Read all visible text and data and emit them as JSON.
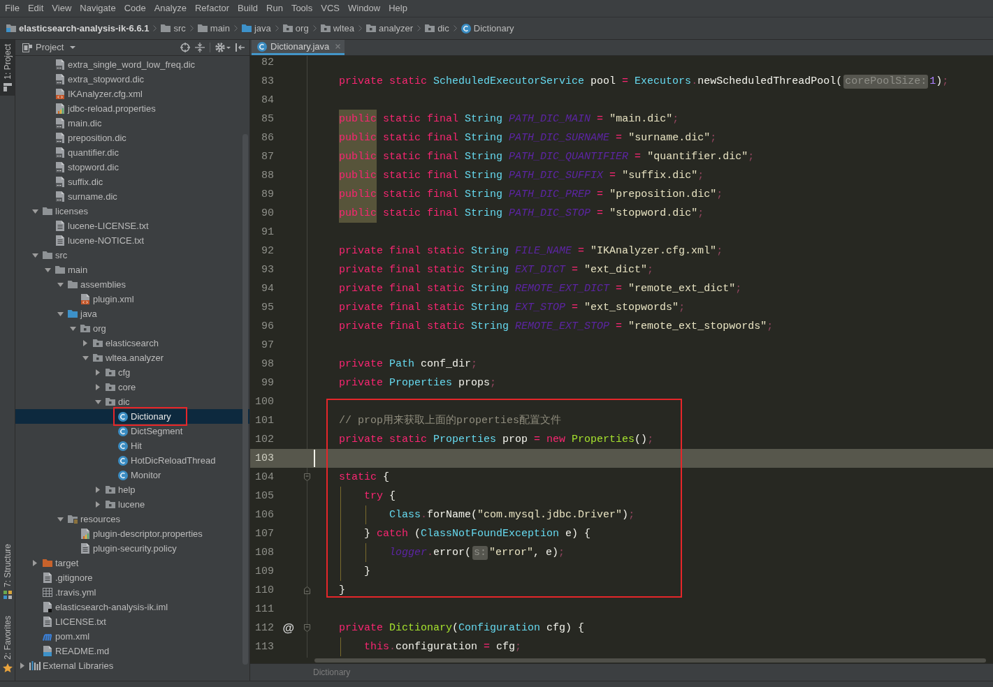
{
  "menu": [
    "File",
    "Edit",
    "View",
    "Navigate",
    "Code",
    "Analyze",
    "Refactor",
    "Build",
    "Run",
    "Tools",
    "VCS",
    "Window",
    "Help"
  ],
  "breadcrumb": [
    {
      "label": "elasticsearch-analysis-ik-6.6.1",
      "kind": "module"
    },
    {
      "label": "src",
      "kind": "folder"
    },
    {
      "label": "main",
      "kind": "folder"
    },
    {
      "label": "java",
      "kind": "source"
    },
    {
      "label": "org",
      "kind": "package"
    },
    {
      "label": "wltea",
      "kind": "package"
    },
    {
      "label": "analyzer",
      "kind": "package"
    },
    {
      "label": "dic",
      "kind": "package"
    },
    {
      "label": "Dictionary",
      "kind": "class"
    }
  ],
  "tool_strip": {
    "top": [
      {
        "label": "1: Project",
        "kind": "project",
        "selected": true
      }
    ],
    "bottom": [
      {
        "label": "7: Structure",
        "kind": "structure",
        "selected": false
      },
      {
        "label": "2: Favorites",
        "kind": "favorites",
        "selected": false
      }
    ]
  },
  "project": {
    "title": "Project",
    "tree": [
      {
        "children": [
          {
            "children": [
              {
                "label": "extra_single_word_low_freq.dic",
                "kind": "dic",
                "selected": false
              },
              {
                "label": "extra_stopword.dic",
                "kind": "dic",
                "selected": false
              },
              {
                "label": "IKAnalyzer.cfg.xml",
                "kind": "xml",
                "selected": false
              },
              {
                "label": "jdbc-reload.properties",
                "kind": "properties",
                "selected": false
              },
              {
                "label": "main.dic",
                "kind": "dic",
                "selected": false
              },
              {
                "label": "preposition.dic",
                "kind": "dic",
                "selected": false
              },
              {
                "label": "quantifier.dic",
                "kind": "dic",
                "selected": false
              },
              {
                "label": "stopword.dic",
                "kind": "dic",
                "selected": false
              },
              {
                "label": "suffix.dic",
                "kind": "dic",
                "selected": false
              },
              {
                "label": "surname.dic",
                "kind": "dic",
                "selected": false
              }
            ]
          },
          {
            "label": "licenses",
            "kind": "folder",
            "expanded": true,
            "selected": false,
            "children": [
              {
                "label": "lucene-LICENSE.txt",
                "kind": "text",
                "selected": false
              },
              {
                "label": "lucene-NOTICE.txt",
                "kind": "text",
                "selected": false
              }
            ]
          },
          {
            "label": "src",
            "kind": "folder",
            "expanded": true,
            "selected": false,
            "children": [
              {
                "label": "main",
                "kind": "folder",
                "expanded": true,
                "selected": false,
                "children": [
                  {
                    "label": "assemblies",
                    "kind": "folder",
                    "expanded": true,
                    "selected": false,
                    "children": [
                      {
                        "label": "plugin.xml",
                        "kind": "xml",
                        "selected": false
                      }
                    ]
                  },
                  {
                    "label": "java",
                    "kind": "source",
                    "expanded": true,
                    "selected": false,
                    "children": [
                      {
                        "label": "org",
                        "kind": "package",
                        "expanded": true,
                        "selected": false,
                        "children": [
                          {
                            "label": "elasticsearch",
                            "kind": "package",
                            "expanded": false,
                            "selected": false
                          },
                          {
                            "label": "wltea.analyzer",
                            "kind": "package",
                            "expanded": true,
                            "selected": false,
                            "children": [
                              {
                                "label": "cfg",
                                "kind": "package",
                                "expanded": false,
                                "selected": false
                              },
                              {
                                "label": "core",
                                "kind": "package",
                                "expanded": false,
                                "selected": false
                              },
                              {
                                "label": "dic",
                                "kind": "package",
                                "expanded": true,
                                "selected": false,
                                "children": [
                                  {
                                    "label": "Dictionary",
                                    "kind": "class",
                                    "selected": true
                                  },
                                  {
                                    "label": "DictSegment",
                                    "kind": "class",
                                    "selected": false
                                  },
                                  {
                                    "label": "Hit",
                                    "kind": "class",
                                    "selected": false
                                  },
                                  {
                                    "label": "HotDicReloadThread",
                                    "kind": "class",
                                    "selected": false
                                  },
                                  {
                                    "label": "Monitor",
                                    "kind": "class",
                                    "selected": false
                                  }
                                ]
                              },
                              {
                                "label": "help",
                                "kind": "package",
                                "expanded": false,
                                "selected": false
                              },
                              {
                                "label": "lucene",
                                "kind": "package",
                                "expanded": false,
                                "selected": false
                              }
                            ]
                          }
                        ]
                      }
                    ]
                  },
                  {
                    "label": "resources",
                    "kind": "resources",
                    "expanded": true,
                    "selected": false,
                    "children": [
                      {
                        "label": "plugin-descriptor.properties",
                        "kind": "properties",
                        "selected": false
                      },
                      {
                        "label": "plugin-security.policy",
                        "kind": "text",
                        "selected": false
                      }
                    ]
                  }
                ]
              }
            ]
          },
          {
            "label": "target",
            "kind": "excluded",
            "expanded": false,
            "selected": false
          },
          {
            "label": ".gitignore",
            "kind": "text",
            "selected": false
          },
          {
            "label": ".travis.yml",
            "kind": "table",
            "selected": false
          },
          {
            "label": "elasticsearch-analysis-ik.iml",
            "kind": "module_file",
            "selected": false
          },
          {
            "label": "LICENSE.txt",
            "kind": "text",
            "selected": false
          },
          {
            "label": "pom.xml",
            "kind": "maven",
            "selected": false
          },
          {
            "label": "README.md",
            "kind": "markdown",
            "selected": false
          }
        ]
      },
      {
        "label": "External Libraries",
        "kind": "libraries",
        "expanded": false,
        "selected": false
      }
    ]
  },
  "editor": {
    "tab": {
      "label": "Dictionary.java",
      "selected": true
    },
    "lines": [
      {
        "number": "82",
        "current": false
      },
      {
        "number": "83",
        "current": false,
        "tokens": [
          {
            "kind": "kw",
            "text": "    private static "
          },
          {
            "kind": "type",
            "text": "ScheduledExecutorService"
          },
          {
            "kind": "plain",
            "text": " pool"
          },
          {
            "kind": "op",
            "text": " = "
          },
          {
            "kind": "type",
            "text": "Executors"
          },
          {
            "kind": "dim",
            "text": "."
          },
          {
            "kind": "plain",
            "text": "newScheduledThreadPool("
          },
          {
            "kind": "hint",
            "text": "corePoolSize:"
          },
          {
            "kind": "num",
            "text": "1"
          },
          {
            "kind": "plain",
            "text": ")"
          },
          {
            "kind": "dim",
            "text": ";"
          }
        ]
      },
      {
        "number": "84",
        "current": false
      },
      {
        "number": "85",
        "current": false,
        "tokens": [
          {
            "kind": "kw_warn",
            "text": "    public"
          },
          {
            "kind": "kw",
            "text": " static final "
          },
          {
            "kind": "type",
            "text": "String "
          },
          {
            "kind": "const",
            "text": "PATH_DIC_MAIN"
          },
          {
            "kind": "op",
            "text": " = "
          },
          {
            "kind": "str",
            "text": "\"main.dic\""
          },
          {
            "kind": "dim",
            "text": ";"
          }
        ]
      },
      {
        "number": "86",
        "current": false,
        "tokens": [
          {
            "kind": "kw_warn",
            "text": "    public"
          },
          {
            "kind": "kw",
            "text": " static final "
          },
          {
            "kind": "type",
            "text": "String "
          },
          {
            "kind": "const",
            "text": "PATH_DIC_SURNAME"
          },
          {
            "kind": "op",
            "text": " = "
          },
          {
            "kind": "str",
            "text": "\"surname.dic\""
          },
          {
            "kind": "dim",
            "text": ";"
          }
        ]
      },
      {
        "number": "87",
        "current": false,
        "tokens": [
          {
            "kind": "kw_warn",
            "text": "    public"
          },
          {
            "kind": "kw",
            "text": " static final "
          },
          {
            "kind": "type",
            "text": "String "
          },
          {
            "kind": "const",
            "text": "PATH_DIC_QUANTIFIER"
          },
          {
            "kind": "op",
            "text": " = "
          },
          {
            "kind": "str",
            "text": "\"quantifier.dic\""
          },
          {
            "kind": "dim",
            "text": ";"
          }
        ]
      },
      {
        "number": "88",
        "current": false,
        "tokens": [
          {
            "kind": "kw_warn",
            "text": "    public"
          },
          {
            "kind": "kw",
            "text": " static final "
          },
          {
            "kind": "type",
            "text": "String "
          },
          {
            "kind": "const",
            "text": "PATH_DIC_SUFFIX"
          },
          {
            "kind": "op",
            "text": " = "
          },
          {
            "kind": "str",
            "text": "\"suffix.dic\""
          },
          {
            "kind": "dim",
            "text": ";"
          }
        ]
      },
      {
        "number": "89",
        "current": false,
        "tokens": [
          {
            "kind": "kw_warn",
            "text": "    public"
          },
          {
            "kind": "kw",
            "text": " static final "
          },
          {
            "kind": "type",
            "text": "String "
          },
          {
            "kind": "const",
            "text": "PATH_DIC_PREP"
          },
          {
            "kind": "op",
            "text": " = "
          },
          {
            "kind": "str",
            "text": "\"preposition.dic\""
          },
          {
            "kind": "dim",
            "text": ";"
          }
        ]
      },
      {
        "number": "90",
        "current": false,
        "tokens": [
          {
            "kind": "kw_warn",
            "text": "    public"
          },
          {
            "kind": "kw",
            "text": " static final "
          },
          {
            "kind": "type",
            "text": "String "
          },
          {
            "kind": "const",
            "text": "PATH_DIC_STOP"
          },
          {
            "kind": "op",
            "text": " = "
          },
          {
            "kind": "str",
            "text": "\"stopword.dic\""
          },
          {
            "kind": "dim",
            "text": ";"
          }
        ]
      },
      {
        "number": "91",
        "current": false
      },
      {
        "number": "92",
        "current": false,
        "tokens": [
          {
            "kind": "kw",
            "text": "    private final static "
          },
          {
            "kind": "type",
            "text": "String "
          },
          {
            "kind": "const",
            "text": "FILE_NAME"
          },
          {
            "kind": "op",
            "text": " = "
          },
          {
            "kind": "str",
            "text": "\"IKAnalyzer.cfg.xml\""
          },
          {
            "kind": "dim",
            "text": ";"
          }
        ]
      },
      {
        "number": "93",
        "current": false,
        "tokens": [
          {
            "kind": "kw",
            "text": "    private final static "
          },
          {
            "kind": "type",
            "text": "String "
          },
          {
            "kind": "const",
            "text": "EXT_DICT"
          },
          {
            "kind": "op",
            "text": " = "
          },
          {
            "kind": "str",
            "text": "\"ext_dict\""
          },
          {
            "kind": "dim",
            "text": ";"
          }
        ]
      },
      {
        "number": "94",
        "current": false,
        "tokens": [
          {
            "kind": "kw",
            "text": "    private final static "
          },
          {
            "kind": "type",
            "text": "String "
          },
          {
            "kind": "const",
            "text": "REMOTE_EXT_DICT"
          },
          {
            "kind": "op",
            "text": " = "
          },
          {
            "kind": "str",
            "text": "\"remote_ext_dict\""
          },
          {
            "kind": "dim",
            "text": ";"
          }
        ]
      },
      {
        "number": "95",
        "current": false,
        "tokens": [
          {
            "kind": "kw",
            "text": "    private final static "
          },
          {
            "kind": "type",
            "text": "String "
          },
          {
            "kind": "const",
            "text": "EXT_STOP"
          },
          {
            "kind": "op",
            "text": " = "
          },
          {
            "kind": "str",
            "text": "\"ext_stopwords\""
          },
          {
            "kind": "dim",
            "text": ";"
          }
        ]
      },
      {
        "number": "96",
        "current": false,
        "tokens": [
          {
            "kind": "kw",
            "text": "    private final static "
          },
          {
            "kind": "type",
            "text": "String "
          },
          {
            "kind": "const",
            "text": "REMOTE_EXT_STOP"
          },
          {
            "kind": "op",
            "text": " = "
          },
          {
            "kind": "str",
            "text": "\"remote_ext_stopwords\""
          },
          {
            "kind": "dim",
            "text": ";"
          }
        ]
      },
      {
        "number": "97",
        "current": false
      },
      {
        "number": "98",
        "current": false,
        "tokens": [
          {
            "kind": "kw",
            "text": "    private "
          },
          {
            "kind": "type",
            "text": "Path"
          },
          {
            "kind": "plain",
            "text": " conf_dir"
          },
          {
            "kind": "dim",
            "text": ";"
          }
        ]
      },
      {
        "number": "99",
        "current": false,
        "tokens": [
          {
            "kind": "kw",
            "text": "    private "
          },
          {
            "kind": "type",
            "text": "Properties"
          },
          {
            "kind": "plain",
            "text": " props"
          },
          {
            "kind": "dim",
            "text": ";"
          }
        ]
      },
      {
        "number": "100",
        "current": false
      },
      {
        "number": "101",
        "current": false,
        "tokens": [
          {
            "kind": "comment",
            "text": "    // prop用来获取上面的properties配置文件"
          }
        ]
      },
      {
        "number": "102",
        "current": false,
        "tokens": [
          {
            "kind": "kw",
            "text": "    private static "
          },
          {
            "kind": "type",
            "text": "Properties"
          },
          {
            "kind": "plain",
            "text": " prop"
          },
          {
            "kind": "op",
            "text": " = "
          },
          {
            "kind": "kw",
            "text": "new "
          },
          {
            "kind": "call",
            "text": "Properties"
          },
          {
            "kind": "plain",
            "text": "()"
          },
          {
            "kind": "dim",
            "text": ";"
          }
        ]
      },
      {
        "number": "103",
        "current": true
      },
      {
        "number": "104",
        "current": false,
        "fold_start": true,
        "tokens": [
          {
            "kind": "kw",
            "text": "    static"
          },
          {
            "kind": "plain",
            "text": " {"
          }
        ]
      },
      {
        "number": "105",
        "current": false,
        "tokens": [
          {
            "kind": "kw",
            "text": "        try"
          },
          {
            "kind": "plain",
            "text": " {"
          }
        ]
      },
      {
        "number": "106",
        "current": false,
        "tokens": [
          {
            "kind": "type",
            "text": "            Class"
          },
          {
            "kind": "dim",
            "text": "."
          },
          {
            "kind": "plain",
            "text": "forName("
          },
          {
            "kind": "str",
            "text": "\"com.mysql.jdbc.Driver\""
          },
          {
            "kind": "plain",
            "text": ")"
          },
          {
            "kind": "dim",
            "text": ";"
          }
        ]
      },
      {
        "number": "107",
        "current": false,
        "tokens": [
          {
            "kind": "plain",
            "text": "        } "
          },
          {
            "kind": "kw",
            "text": "catch"
          },
          {
            "kind": "plain",
            "text": " ("
          },
          {
            "kind": "type",
            "text": "ClassNotFoundException"
          },
          {
            "kind": "plain",
            "text": " e) {"
          }
        ]
      },
      {
        "number": "108",
        "current": false,
        "tokens": [
          {
            "kind": "const",
            "text": "            logger"
          },
          {
            "kind": "dim",
            "text": "."
          },
          {
            "kind": "plain",
            "text": "error("
          },
          {
            "kind": "hint",
            "text": "s:"
          },
          {
            "kind": "str",
            "text": "\"error\""
          },
          {
            "kind": "plain",
            "text": ", e)"
          },
          {
            "kind": "dim",
            "text": ";"
          }
        ]
      },
      {
        "number": "109",
        "current": false,
        "tokens": [
          {
            "kind": "plain",
            "text": "        }"
          }
        ]
      },
      {
        "number": "110",
        "current": false,
        "fold_end": true,
        "tokens": [
          {
            "kind": "plain",
            "text": "    }"
          }
        ]
      },
      {
        "number": "111",
        "current": false
      },
      {
        "number": "112",
        "current": false,
        "marker": "@",
        "fold_start": true,
        "tokens": [
          {
            "kind": "kw",
            "text": "    private "
          },
          {
            "kind": "call",
            "text": "Dictionary"
          },
          {
            "kind": "plain",
            "text": "("
          },
          {
            "kind": "type",
            "text": "Configuration"
          },
          {
            "kind": "plain",
            "text": " cfg) {"
          }
        ]
      },
      {
        "number": "113",
        "current": false,
        "tokens": [
          {
            "kind": "kw",
            "text": "        this"
          },
          {
            "kind": "dim",
            "text": "."
          },
          {
            "kind": "plain",
            "text": "configuration"
          },
          {
            "kind": "op",
            "text": " = "
          },
          {
            "kind": "plain",
            "text": "cfg"
          },
          {
            "kind": "dim",
            "text": ";"
          }
        ]
      }
    ],
    "footer": {
      "breadcrumb": "Dictionary"
    }
  }
}
